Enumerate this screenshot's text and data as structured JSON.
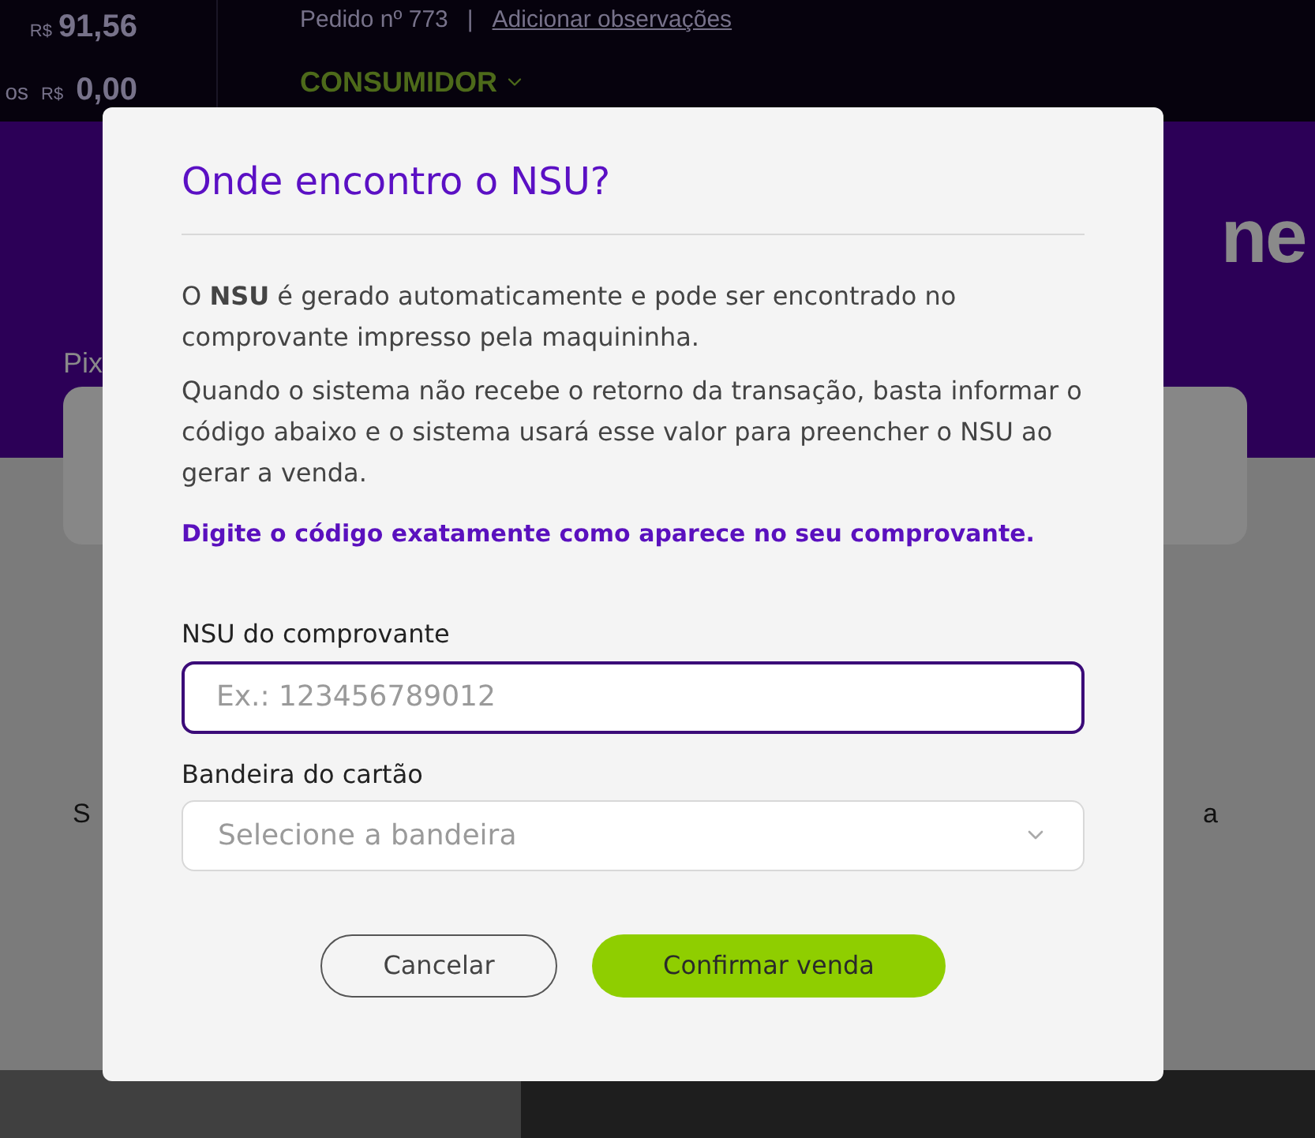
{
  "header": {
    "subtotal_currency": "R$",
    "subtotal": "91,56",
    "discount_label": "os",
    "discount_currency": "R$",
    "discount": "0,00",
    "order": "Pedido nº 773",
    "separator": "|",
    "notes_link": "Adicionar observações",
    "customer": "CONSUMIDOR"
  },
  "background": {
    "brand_fragment": "ne",
    "pix_label": "Pix",
    "left_fragment": "S",
    "right_fragment": "a"
  },
  "dialog": {
    "title": "Onde encontro o NSU?",
    "paragraphs": [
      "O **NSU** é gerado automaticamente e pode ser encontrado no comprovante impresso pela maquininha.",
      "Quando o sistema não recebe o retorno da transação, basta informar o código abaixo e o sistema usará esse valor para preencher o NSU ao gerar a venda."
    ],
    "highlight": "Digite o código exatamente como aparece no seu comprovante.",
    "nsu_field": {
      "label": "NSU do comprovante",
      "placeholder": "Ex.: 123456789012",
      "focused": true
    },
    "brand_select": {
      "label": "Bandeira do cartão",
      "placeholder": "Selecione a bandeira"
    },
    "buttons": [
      {
        "label": "Cancelar",
        "kind": "secondary"
      },
      {
        "label": "Confirmar venda",
        "kind": "primary"
      }
    ]
  }
}
